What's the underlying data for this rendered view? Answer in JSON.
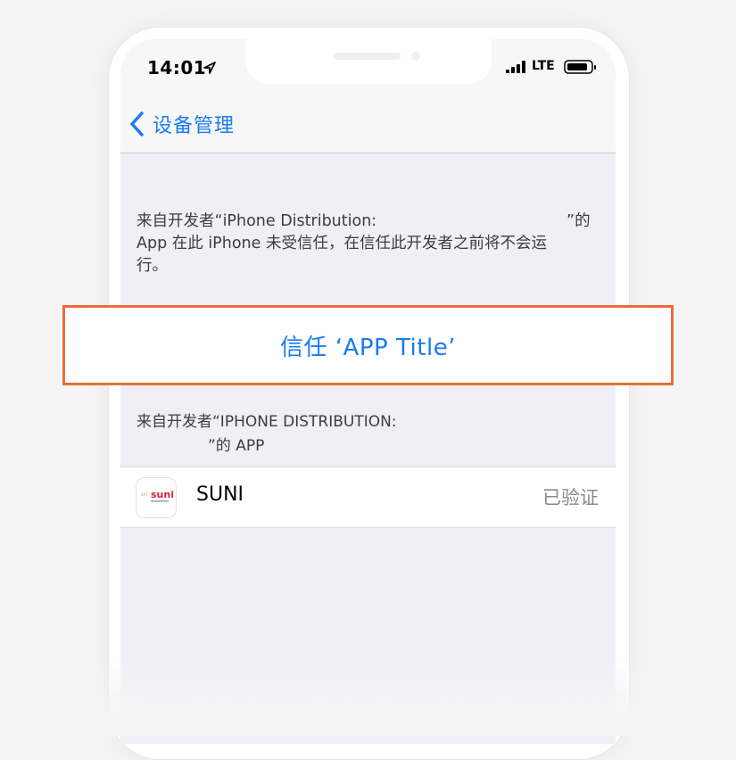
{
  "status_bar": {
    "time": "14:01",
    "carrier": "LTE"
  },
  "nav": {
    "back_label": "设备管理"
  },
  "trust_description": {
    "line1": "来自开发者“iPhone Distribution:",
    "line1_end": "”的",
    "line2": "App 在此 iPhone 未受信任，在信任此开发者之前将不会运",
    "line3": "行。"
  },
  "trust_button": {
    "label": "信任 ‘APP Title’"
  },
  "apps_section": {
    "header_line1": "来自开发者“IPHONE DISTRIBUTION:",
    "header_line2": "”的 APP",
    "apps": [
      {
        "name": "SUNI",
        "status": "已验证",
        "icon_text": "suni"
      }
    ]
  },
  "colors": {
    "accent": "#1a7cf0",
    "highlight_border": "#f06a3c",
    "secondary_text": "#8a8a8e"
  }
}
